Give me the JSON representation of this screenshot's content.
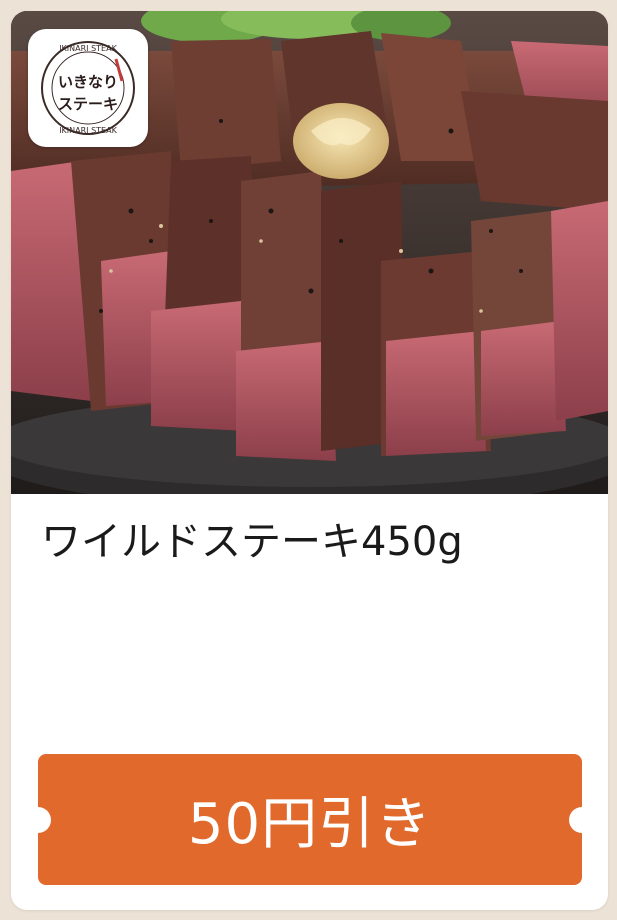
{
  "card": {
    "image": {
      "alt": "steak-photo",
      "logo": {
        "text_main": "いきなりステーキ",
        "text_ring": "IKINARI STEAK"
      }
    },
    "title": "ワイルドステーキ450g",
    "coupon": {
      "label": "50円引き"
    }
  },
  "colors": {
    "background": "#ece3d6",
    "card": "#ffffff",
    "button": "#e2692c",
    "button_text": "#ffffff",
    "title_text": "#1a1a1a"
  }
}
